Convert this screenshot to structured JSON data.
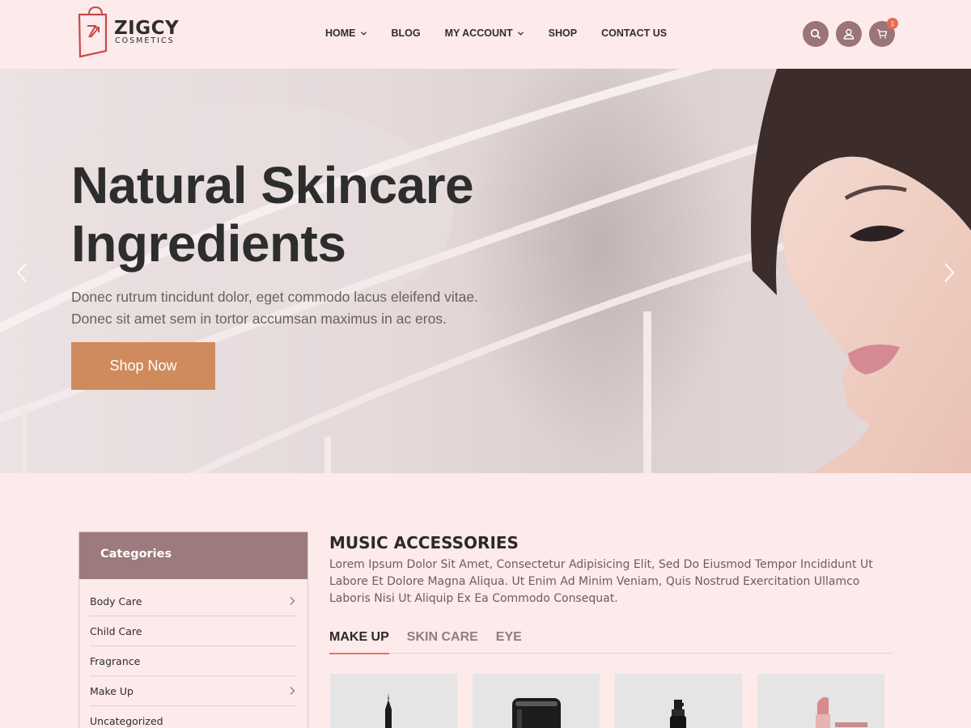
{
  "brand": {
    "name": "ZIGCY",
    "tagline": "COSMETICS"
  },
  "nav": [
    {
      "label": "HOME",
      "dropdown": true
    },
    {
      "label": "BLOG",
      "dropdown": false
    },
    {
      "label": "MY ACCOUNT",
      "dropdown": true
    },
    {
      "label": "SHOP",
      "dropdown": false
    },
    {
      "label": "CONTACT US",
      "dropdown": false
    }
  ],
  "header_icons": {
    "search": "search-icon",
    "account": "user-icon",
    "cart": "cart-icon",
    "cart_count": "1"
  },
  "hero": {
    "title_line1": "Natural Skincare",
    "title_line2": "Ingredients",
    "subtitle_line1": "Donec rutrum tincidunt dolor, eget commodo lacus eleifend vitae.",
    "subtitle_line2": "Donec sit amet sem in tortor accumsan maximus in ac eros.",
    "button": "Shop Now"
  },
  "sidebar": {
    "title": "Categories",
    "items": [
      {
        "label": "Body Care",
        "has_children": true
      },
      {
        "label": "Child Care",
        "has_children": false
      },
      {
        "label": "Fragrance",
        "has_children": false
      },
      {
        "label": "Make Up",
        "has_children": true
      },
      {
        "label": "Uncategorized",
        "has_children": false
      }
    ]
  },
  "section": {
    "title": "MUSIC ACCESSORIES",
    "description": "Lorem Ipsum Dolor Sit Amet, Consectetur Adipisicing Elit, Sed Do Eiusmod Tempor Incididunt Ut Labore Et Dolore Magna Aliqua. Ut Enim Ad Minim Veniam, Quis Nostrud Exercitation Ullamco Laboris Nisi Ut Aliquip Ex Ea Commodo Consequat.",
    "tabs": [
      {
        "label": "MAKE UP",
        "active": true
      },
      {
        "label": "SKIN CARE",
        "active": false
      },
      {
        "label": "EYE",
        "active": false
      }
    ]
  },
  "products": [
    {
      "type": "eyeliner-pen"
    },
    {
      "type": "cream-jar"
    },
    {
      "type": "spray-bottle"
    },
    {
      "type": "lipstick"
    }
  ],
  "colors": {
    "background": "#fdeaea",
    "accent_button": "#cf8b5c",
    "sidebar_header": "#9d7a7d",
    "icon_circle": "#9b7477",
    "tab_underline": "#d9786a"
  }
}
